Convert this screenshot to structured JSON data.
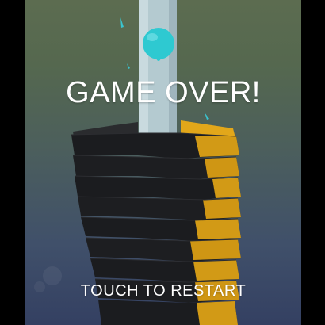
{
  "game": {
    "status_title": "GAME OVER!",
    "restart_prompt": "TOUCH TO RESTART"
  },
  "colors": {
    "background_top": "#5c6c50",
    "background_bottom": "#344062",
    "platform_dark": "#1b1c1f",
    "platform_accent": "#d29a16",
    "pole": "#b4cad0",
    "ball": "#2ec9d1",
    "letterbox": "#000000"
  },
  "icons": {
    "ball": "ball-icon",
    "tower": "helix-tower",
    "pole": "center-pole"
  }
}
